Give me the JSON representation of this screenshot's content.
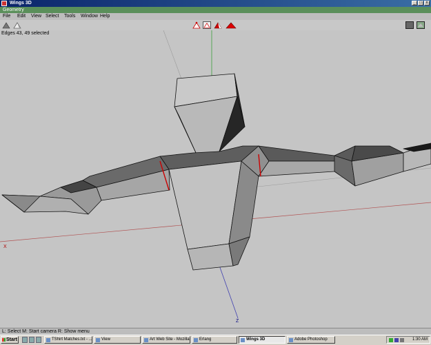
{
  "window": {
    "title": "Wings 3D",
    "buttons": [
      "_",
      "□",
      "x"
    ]
  },
  "geometry_bar": {
    "label": "Geometry"
  },
  "menu": [
    "File",
    "Edit",
    "View",
    "Select",
    "Tools",
    "Window",
    "Help"
  ],
  "viewport": {
    "selection_info": "Edges 43, 49 selected",
    "axis_x_label": "X",
    "axis_z_label": "Z"
  },
  "status_bar": {
    "text": "L: Select   M: Start camera   R: Show menu"
  },
  "taskbar": {
    "start_label": "Start",
    "tasks": [
      "TShirt Matches.txt - ...",
      "View",
      "Art Web Site - Mozilla",
      "Erlang",
      "Wings 3D",
      "Adobe Photoshop"
    ],
    "active_task": "Wings 3D",
    "clock": "1:30 AM"
  },
  "colors": {
    "titlebar": "#0a246a",
    "geometry_bar": "#5a8f5a",
    "viewport_bg": "#c5c5c5",
    "select_mode": "#cc0000"
  }
}
